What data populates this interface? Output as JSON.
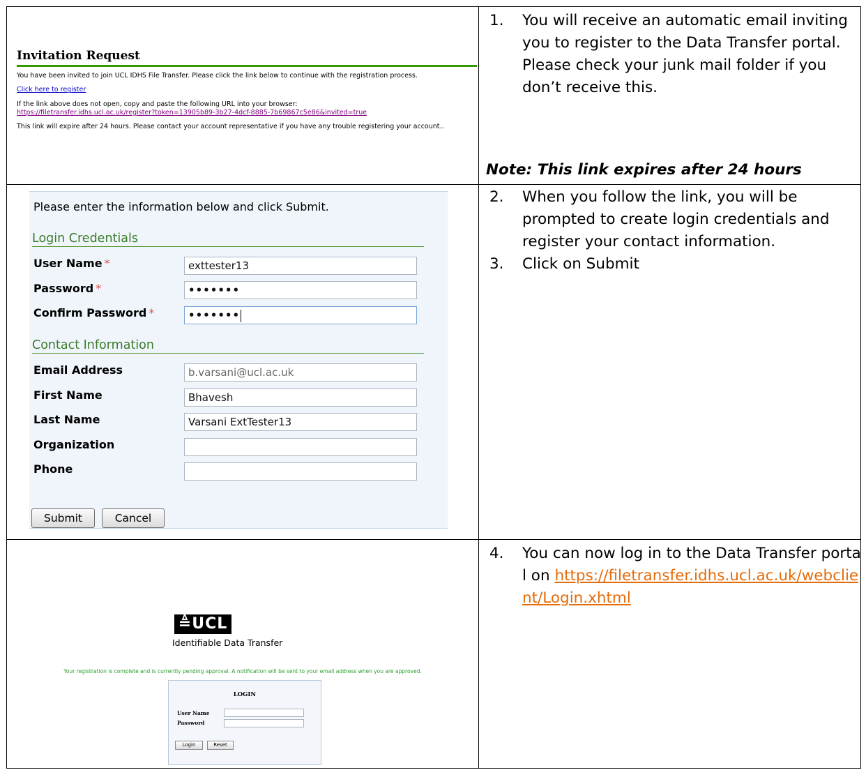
{
  "invitation_email": {
    "title": "Invitation Request",
    "invite_text": "You have been invited to join UCL IDHS File Transfer. Please click the link below to continue with the registration process.",
    "register_link": "Click here to register",
    "fallback_text": "If the link above does not open, copy and paste the following URL into your browser:",
    "register_url": "https://filetransfer.idhs.ucl.ac.uk/register?token=13905b89-3b27-4dcf-8885-7b69867c5e86&invited=true",
    "expiry_text": "This link will expire after 24 hours. Please contact your account representative if you have any trouble registering your account.."
  },
  "steps": {
    "step1_num": "1.",
    "step1_text": "You will receive an automatic email inviting you to register to the Data Transfer portal. Please check your junk mail folder if you don’t receive this.",
    "note": "Note: This link expires after 24 hours",
    "step2_num": "2.",
    "step2_text": "When you follow the link, you will be prompted to create login credentials and register your contact information.",
    "step3_num": "3.",
    "step3_text": "Click on Submit",
    "step4_num": "4.",
    "step4_text": "You can now log in to the Data Transfer portal on",
    "step4_link": "https://filetransfer.idhs.ucl.ac.uk/webclient/Login.xhtml"
  },
  "registration_form": {
    "intro": "Please enter the information below and click Submit.",
    "section_login": "Login Credentials",
    "user_name_label": "User Name",
    "password_label": "Password",
    "confirm_password_label": "Confirm Password",
    "required_mark": "*",
    "user_name_value": "exttester13",
    "password_value": "•••••••",
    "confirm_password_value": "•••••••",
    "section_contact": "Contact Information",
    "email_label": "Email Address",
    "email_value": "b.varsani@ucl.ac.uk",
    "first_name_label": "First Name",
    "first_name_value": "Bhavesh",
    "last_name_label": "Last Name",
    "last_name_value": "Varsani ExtTester13",
    "organization_label": "Organization",
    "organization_value": "",
    "phone_label": "Phone",
    "phone_value": "",
    "submit_label": "Submit",
    "cancel_label": "Cancel"
  },
  "login_page": {
    "logo_text": "≜UCL",
    "subtitle": "Identifiable Data Transfer",
    "pending_message": "Your registration is complete and is currently pending approval. A notification will be sent to your email address when you are approved.",
    "login_title": "LOGIN",
    "user_name_label": "User Name",
    "password_label": "Password",
    "login_button": "Login",
    "reset_button": "Reset"
  }
}
